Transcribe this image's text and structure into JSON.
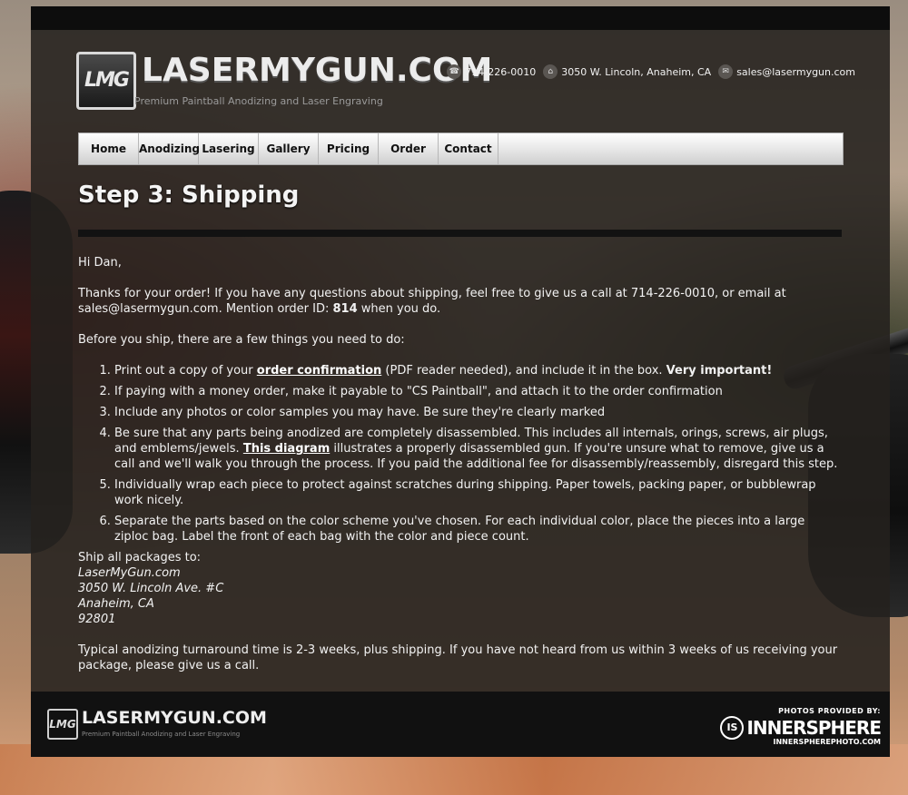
{
  "header": {
    "logo_mark": "LMG",
    "logo_text": "LASERMYGUN.COM",
    "tagline": "Premium Paintball Anodizing and Laser Engraving",
    "phone": "714-226-0010",
    "address": "3050 W. Lincoln, Anaheim, CA",
    "email": "sales@lasermygun.com",
    "icons": {
      "phone": "phone-icon",
      "address": "home-icon",
      "email": "mail-icon"
    }
  },
  "nav": {
    "items": [
      {
        "label": "Home"
      },
      {
        "label": "Anodizing"
      },
      {
        "label": "Lasering"
      },
      {
        "label": "Gallery"
      },
      {
        "label": "Pricing"
      },
      {
        "label": "Order"
      },
      {
        "label": "Contact"
      }
    ]
  },
  "page": {
    "title": "Step 3: Shipping",
    "greeting": "Hi Dan,",
    "thanks_1": "Thanks for your order! If you have any questions about shipping, feel free to give us a call at 714-226-0010, or email at sales@lasermygun.com. Mention order ID: ",
    "order_id": "814",
    "thanks_2": " when you do.",
    "before_ship": "Before you ship, there are a few things you need to do:",
    "steps": {
      "s1_a": "Print out a copy of your ",
      "s1_link": "order confirmation",
      "s1_b": " (PDF reader needed), and include it in the box. ",
      "s1_bold": "Very important!",
      "s2": "If paying with a money order, make it payable to \"CS Paintball\", and attach it to the order confirmation",
      "s3": "Include any photos or color samples you may have. Be sure they're clearly marked",
      "s4_a": "Be sure that any parts being anodized are completely disassembled. This includes all internals, orings, screws, air plugs, and emblems/jewels. ",
      "s4_link": "This diagram",
      "s4_b": " illustrates a properly disassembled gun. If you're unsure what to remove, give us a call and we'll walk you through the process. If you paid the additional fee for disassembly/reassembly, disregard this step.",
      "s5": "Individually wrap each piece to protect against scratches during shipping. Paper towels, packing paper, or bubblewrap work nicely.",
      "s6": "Separate the parts based on the color scheme you've chosen. For each individual color, place the pieces into a large ziploc bag. Label the front of each bag with the color and piece count."
    },
    "ship_to_label": "Ship all packages to:",
    "ship_name": "LaserMyGun.com",
    "ship_street": "3050 W. Lincoln Ave. #C",
    "ship_city": "Anaheim, CA",
    "ship_zip": "92801",
    "turnaround": "Typical anodizing turnaround time is 2-3 weeks, plus shipping. If you have not heard from us within 3 weeks of us receiving your package, please give us a call."
  },
  "footer": {
    "logo_mark": "LMG",
    "logo_text": "LASERMYGUN.COM",
    "tagline": "Premium Paintball Anodizing and Laser Engraving",
    "credits_label": "PHOTOS PROVIDED BY:",
    "credits_mark": "IS",
    "credits_name": "INNERSPHERE",
    "credits_url": "INNERSPHEREPHOTO.COM"
  },
  "colors": {
    "panel": "#24211e",
    "bar": "#0d0d0d",
    "nav_bg": "#e3e3e3",
    "text": "#f2f2f2"
  }
}
